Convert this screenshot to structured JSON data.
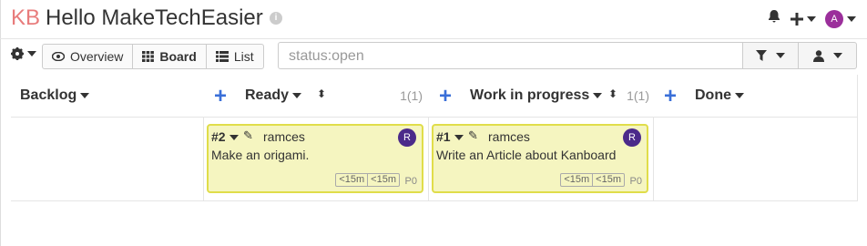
{
  "header": {
    "logo": "KB",
    "title": "Hello MakeTechEasier",
    "info_icon": "info-icon",
    "avatar_letter": "A"
  },
  "toolbar": {
    "views": [
      {
        "label": "Overview",
        "icon": "eye-icon"
      },
      {
        "label": "Board",
        "icon": "grid-icon"
      },
      {
        "label": "List",
        "icon": "list-icon"
      }
    ],
    "search_value": "status:open"
  },
  "columns": [
    {
      "title": "Backlog",
      "count": ""
    },
    {
      "title": "Ready",
      "count": "1(1)"
    },
    {
      "title": "Work in progress",
      "count": "1(1)"
    },
    {
      "title": "Done",
      "count": ""
    }
  ],
  "cards": [
    {
      "number": "#2",
      "owner": "ramces",
      "avatar": "R",
      "title": "Make an origami.",
      "time_estimated": "<15m",
      "time_spent": "<15m",
      "priority": "P0"
    },
    {
      "number": "#1",
      "owner": "ramces",
      "avatar": "R",
      "title": "Write an Article about Kanboard",
      "time_estimated": "<15m",
      "time_spent": "<15m",
      "priority": "P0"
    }
  ],
  "colors": {
    "accent": "#3a6fd8",
    "card_bg": "#f5f5c0",
    "card_border": "#e0dd4a",
    "logo": "#e87c7c"
  }
}
